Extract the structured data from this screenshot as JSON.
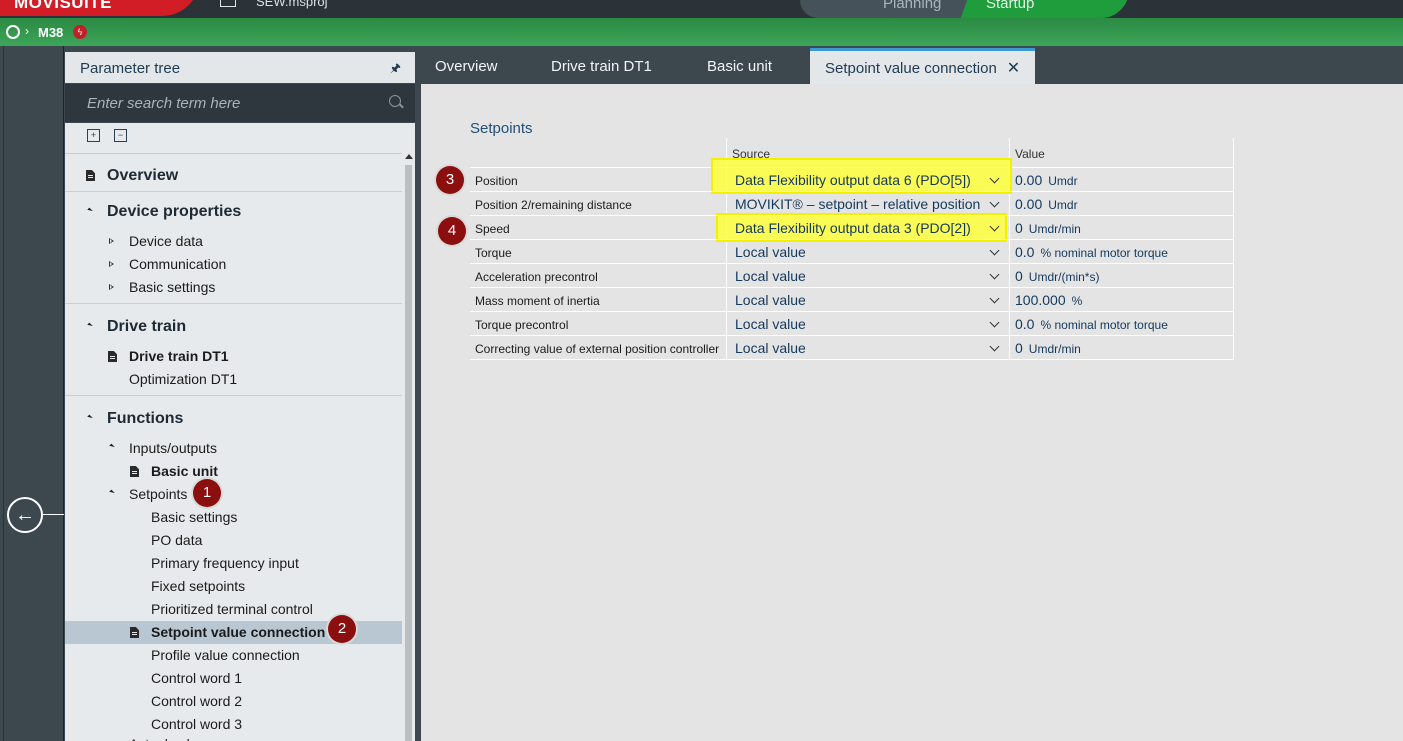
{
  "topbar": {
    "app_name": "MOVISUITE",
    "project_name": "SEW.msproj",
    "mode_tabs": [
      "Planning",
      "Startup"
    ],
    "active_mode": "Startup"
  },
  "breadcrumb": {
    "device": "M38",
    "badge": "ϟ"
  },
  "colors": {
    "accent_green": "#2e9a45",
    "brand_red": "#d21d26",
    "highlight_yellow": "#ffff3c",
    "marker_red": "#8b0f0f",
    "selection_blue": "#b8c7d2"
  },
  "parameter_tree": {
    "title": "Parameter tree",
    "search_placeholder": "Enter search term here",
    "items": {
      "overview": "Overview",
      "device_properties": "Device properties",
      "device_data": "Device data",
      "communication": "Communication",
      "basic_settings": "Basic settings",
      "drive_train": "Drive train",
      "drive_train_dt1": "Drive train DT1",
      "optimization_dt1": "Optimization DT1",
      "functions": "Functions",
      "inputs_outputs": "Inputs/outputs",
      "basic_unit": "Basic unit",
      "setpoints": "Setpoints",
      "sp_basic_settings": "Basic settings",
      "po_data": "PO data",
      "primary_frequency_input": "Primary frequency input",
      "fixed_setpoints": "Fixed setpoints",
      "prioritized_terminal_control": "Prioritized terminal control",
      "setpoint_value_connection": "Setpoint value connection",
      "profile_value_connection": "Profile value connection",
      "control_word_1": "Control word 1",
      "control_word_2": "Control word 2",
      "control_word_3": "Control word 3",
      "actual_values": "Actual values"
    }
  },
  "tabs": {
    "overview": "Overview",
    "drive_train_dt1": "Drive train DT1",
    "basic_unit": "Basic unit",
    "setpoint_value_connection": "Setpoint value connection"
  },
  "markers": [
    "1",
    "2",
    "3",
    "4"
  ],
  "setpoints": {
    "title": "Setpoints",
    "col_source": "Source",
    "col_value": "Value",
    "rows": [
      {
        "label": "Position",
        "source": "Data Flexibility output data 6 (PDO[5])",
        "value": "0.00",
        "unit": "Umdr"
      },
      {
        "label": "Position 2/remaining distance",
        "source": "MOVIKIT® – setpoint – relative position",
        "value": "0.00",
        "unit": "Umdr"
      },
      {
        "label": "Speed",
        "source": "Data Flexibility output data 3 (PDO[2])",
        "value": "0",
        "unit": "Umdr/min"
      },
      {
        "label": "Torque",
        "source": "Local value",
        "value": "0.0",
        "unit": "% nominal motor torque"
      },
      {
        "label": "Acceleration precontrol",
        "source": "Local value",
        "value": "0",
        "unit": "Umdr/(min*s)"
      },
      {
        "label": "Mass moment of inertia",
        "source": "Local value",
        "value": "100.000",
        "unit": "%"
      },
      {
        "label": "Torque precontrol",
        "source": "Local value",
        "value": "0.0",
        "unit": "% nominal motor torque"
      },
      {
        "label": "Correcting value of external position controller",
        "source": "Local value",
        "value": "0",
        "unit": "Umdr/min"
      }
    ]
  }
}
